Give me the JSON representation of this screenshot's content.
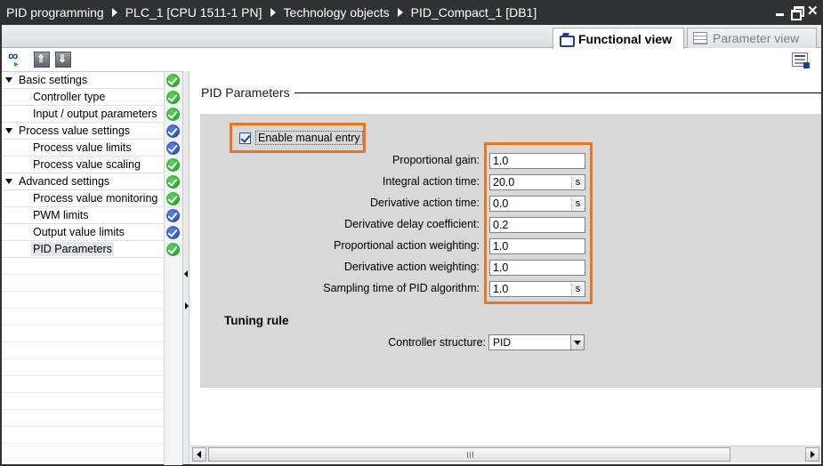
{
  "titlebar": {
    "crumbs": [
      "PID programming",
      "PLC_1 [CPU 1511-1 PN]",
      "Technology objects",
      "PID_Compact_1 [DB1]"
    ]
  },
  "window_buttons": [
    "minimize-icon",
    "restore-icon",
    "close-icon"
  ],
  "view_tabs": {
    "functional": "Functional view",
    "parameter": "Parameter view",
    "active": "functional"
  },
  "toolbar": {
    "icons": [
      "glasses-monitor-icon",
      "collapse-all-icon",
      "expand-all-icon",
      "settings-panel-icon"
    ]
  },
  "nav": {
    "items": [
      {
        "label": "Basic settings",
        "type": "group",
        "status": "ok"
      },
      {
        "label": "Controller type",
        "type": "sub",
        "status": "ok"
      },
      {
        "label": "Input / output parameters",
        "type": "sub",
        "status": "ok"
      },
      {
        "label": "Process value settings",
        "type": "group",
        "status": "info"
      },
      {
        "label": "Process value limits",
        "type": "sub",
        "status": "info"
      },
      {
        "label": "Process value scaling",
        "type": "sub",
        "status": "ok"
      },
      {
        "label": "Advanced settings",
        "type": "group",
        "status": "ok"
      },
      {
        "label": "Process value monitoring",
        "type": "sub",
        "status": "ok"
      },
      {
        "label": "PWM limits",
        "type": "sub",
        "status": "info"
      },
      {
        "label": "Output value limits",
        "type": "sub",
        "status": "info"
      },
      {
        "label": "PID Parameters",
        "type": "sub",
        "status": "ok",
        "selected": true
      }
    ]
  },
  "content": {
    "section_title": "PID Parameters",
    "manual_entry": {
      "label": "Enable manual entry",
      "checked": true
    },
    "parameters": [
      {
        "label": "Proportional gain:",
        "value": "1.0",
        "unit": ""
      },
      {
        "label": "Integral action time:",
        "value": "20.0",
        "unit": "s"
      },
      {
        "label": "Derivative action time:",
        "value": "0.0",
        "unit": "s"
      },
      {
        "label": "Derivative delay coefficient:",
        "value": "0.2",
        "unit": ""
      },
      {
        "label": "Proportional action weighting:",
        "value": "1.0",
        "unit": ""
      },
      {
        "label": "Derivative action weighting:",
        "value": "1.0",
        "unit": ""
      },
      {
        "label": "Sampling time of PID algorithm:",
        "value": "1.0",
        "unit": "s"
      }
    ],
    "tuning_rule": {
      "title": "Tuning rule",
      "structure_label": "Controller structure:",
      "structure_value": "PID"
    }
  },
  "colors": {
    "titlebar_bg": "#2f3133",
    "highlight": "#e87722",
    "status_ok": "#1e9a22",
    "status_info": "#2447b4",
    "panel_bg": "#d8d8d8"
  }
}
